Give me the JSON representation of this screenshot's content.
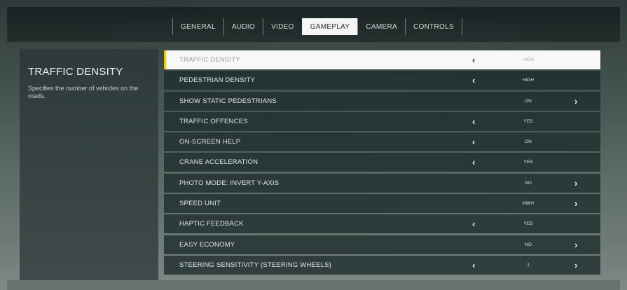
{
  "tabs": [
    {
      "label": "GENERAL"
    },
    {
      "label": "AUDIO"
    },
    {
      "label": "VIDEO"
    },
    {
      "label": "GAMEPLAY"
    },
    {
      "label": "CAMERA"
    },
    {
      "label": "CONTROLS"
    }
  ],
  "active_tab": "GAMEPLAY",
  "info": {
    "title": "TRAFFIC DENSITY",
    "description": "Specifies the number of vehicles on the roads."
  },
  "settings": [
    {
      "label": "TRAFFIC DENSITY",
      "value": "HIGH",
      "left_arrow": "‹",
      "right_arrow": ""
    },
    {
      "label": "PEDESTRIAN DENSITY",
      "value": "HIGH",
      "left_arrow": "‹",
      "right_arrow": ""
    },
    {
      "label": "SHOW STATIC PEDESTRIANS",
      "value": "ON",
      "left_arrow": "",
      "right_arrow": "›"
    },
    {
      "label": "TRAFFIC OFFENCES",
      "value": "YES",
      "left_arrow": "‹",
      "right_arrow": ""
    },
    {
      "label": "ON-SCREEN HELP",
      "value": "ON",
      "left_arrow": "‹",
      "right_arrow": ""
    },
    {
      "label": "CRANE ACCELERATION",
      "value": "YES",
      "left_arrow": "‹",
      "right_arrow": ""
    },
    {
      "label": "PHOTO MODE: INVERT Y-AXIS",
      "value": "NO",
      "left_arrow": "",
      "right_arrow": "›"
    },
    {
      "label": "SPEED UNIT",
      "value": "KM/H",
      "left_arrow": "",
      "right_arrow": "›"
    },
    {
      "label": "HAPTIC FEEDBACK",
      "value": "YES",
      "left_arrow": "‹",
      "right_arrow": ""
    },
    {
      "label": "EASY ECONOMY",
      "value": "NO",
      "left_arrow": "",
      "right_arrow": "›"
    },
    {
      "label": "STEERING SENSITIVITY (STEERING WHEELS)",
      "value": "1",
      "left_arrow": "‹",
      "right_arrow": "›"
    }
  ],
  "colors": {
    "accent": "#f1c21b",
    "selected_row_bg": "#f8f8f8",
    "row_bg": "#1e2a2b"
  },
  "icons": {
    "left": "chevron-left-icon",
    "right": "chevron-right-icon"
  }
}
